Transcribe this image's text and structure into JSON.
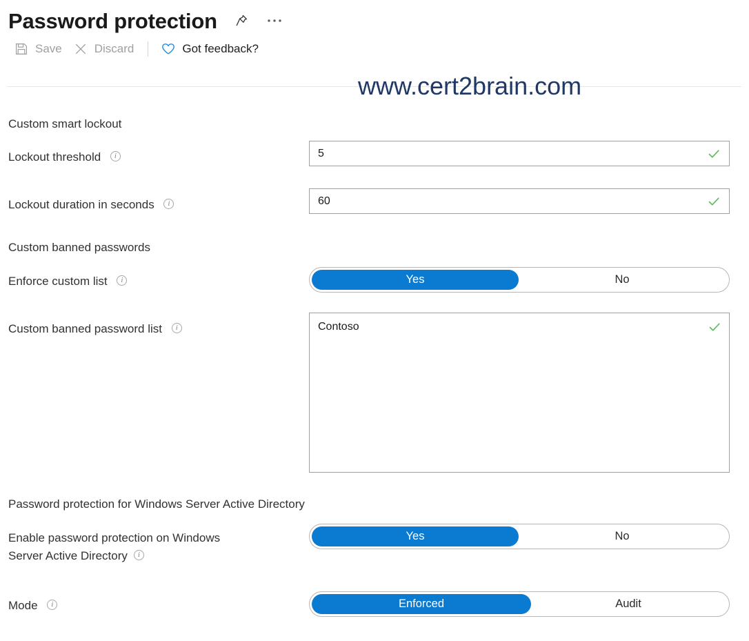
{
  "header": {
    "title": "Password protection",
    "pin_icon": "pin-icon",
    "more_icon": "ellipsis-icon",
    "more_glyph": "• • •"
  },
  "command_bar": {
    "save": {
      "label": "Save",
      "icon": "save-disk-icon",
      "enabled": false
    },
    "discard": {
      "label": "Discard",
      "icon": "close-x-icon",
      "enabled": false
    },
    "feedback": {
      "label": "Got feedback?",
      "icon": "heart-icon",
      "enabled": true
    }
  },
  "watermark": {
    "text": "www.cert2brain.com",
    "color": "#1f3864"
  },
  "sections": {
    "smart_lockout": {
      "heading": "Custom smart lockout",
      "lockout_threshold": {
        "label": "Lockout threshold",
        "value": "5",
        "info_icon": "info-icon",
        "validation_icon": "checkmark-icon"
      },
      "lockout_duration": {
        "label": "Lockout duration in seconds",
        "value": "60",
        "info_icon": "info-icon",
        "validation_icon": "checkmark-icon"
      }
    },
    "banned_passwords": {
      "heading": "Custom banned passwords",
      "enforce_custom_list": {
        "label": "Enforce custom list",
        "info_icon": "info-icon",
        "options": [
          "Yes",
          "No"
        ],
        "selected": "Yes"
      },
      "custom_banned_list": {
        "label": "Custom banned password list",
        "info_icon": "info-icon",
        "value": "Contoso",
        "validation_icon": "checkmark-icon"
      }
    },
    "windows_server_ad": {
      "heading": "Password protection for Windows Server Active Directory",
      "enable_protection": {
        "label_line1": "Enable password protection on Windows",
        "label_line2": "Server Active Directory",
        "info_icon": "info-icon",
        "options": [
          "Yes",
          "No"
        ],
        "selected": "Yes"
      },
      "mode": {
        "label": "Mode",
        "info_icon": "info-icon",
        "options": [
          "Enforced",
          "Audit"
        ],
        "selected": "Enforced"
      }
    }
  },
  "colors": {
    "accent_blue": "#0a7bd1",
    "success_green": "#5cb85c",
    "text_primary": "#1b1a19",
    "text_disabled": "#a19f9d",
    "border": "#a19f9d"
  }
}
